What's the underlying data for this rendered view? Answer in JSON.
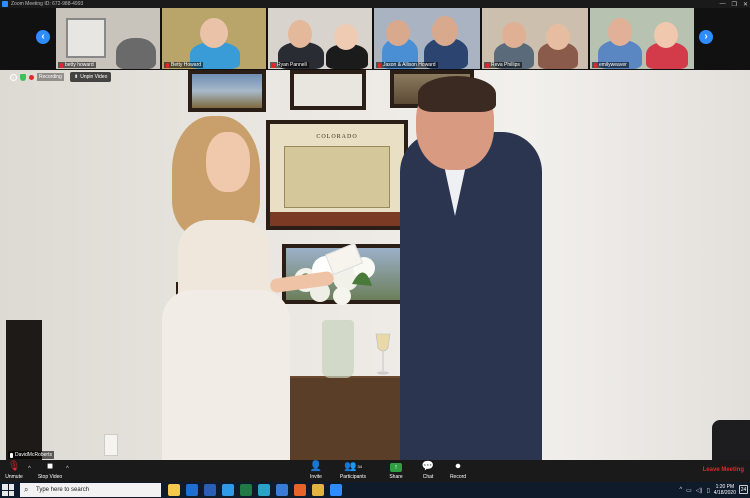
{
  "window": {
    "title": "Zoom Meeting ID: 672-988-4993",
    "controls": [
      "—",
      "❐",
      "✕"
    ]
  },
  "gallery": {
    "participants": [
      {
        "name": "betty howard"
      },
      {
        "name": "Betty Howard"
      },
      {
        "name": "Ryan Pannell"
      },
      {
        "name": "Jason & Allison Howard"
      },
      {
        "name": "Reva Phillips"
      },
      {
        "name": "emilyweaver"
      }
    ]
  },
  "main_video": {
    "recording_label": "Recording",
    "unpin_label": "Unpin Video",
    "map_title": "COLORADO",
    "speaker_name": "DavidMcRoberts"
  },
  "toolbar": {
    "unmute_label": "Unmute",
    "stop_video_label": "Stop Video",
    "invite_label": "Invite",
    "participants_label": "Participants",
    "participants_count": "34",
    "share_label": "Share",
    "chat_label": "Chat",
    "record_label": "Record",
    "leave_label": "Leave Meeting"
  },
  "taskbar": {
    "search_placeholder": "Type here to search",
    "time": "1:20 PM",
    "date": "4/18/2020",
    "notification_count": "24",
    "apps": [
      {
        "name": "file-explorer-icon",
        "color": "#f2c94c"
      },
      {
        "name": "outlook-icon",
        "color": "#1d6fd1"
      },
      {
        "name": "word-icon",
        "color": "#2b5fb5"
      },
      {
        "name": "edge-icon",
        "color": "#2f9be8"
      },
      {
        "name": "excel-icon",
        "color": "#1f7a45"
      },
      {
        "name": "sketchup-icon",
        "color": "#2aa3c7"
      },
      {
        "name": "store-icon",
        "color": "#3a7bd5"
      },
      {
        "name": "firefox-icon",
        "color": "#e8632a"
      },
      {
        "name": "chrome-icon",
        "color": "#e3b341"
      },
      {
        "name": "zoom-icon",
        "color": "#2d8cff"
      }
    ]
  },
  "colors": {
    "zoom_blue": "#2d8cff",
    "leave_red": "#e02828",
    "share_green": "#2ea043"
  }
}
